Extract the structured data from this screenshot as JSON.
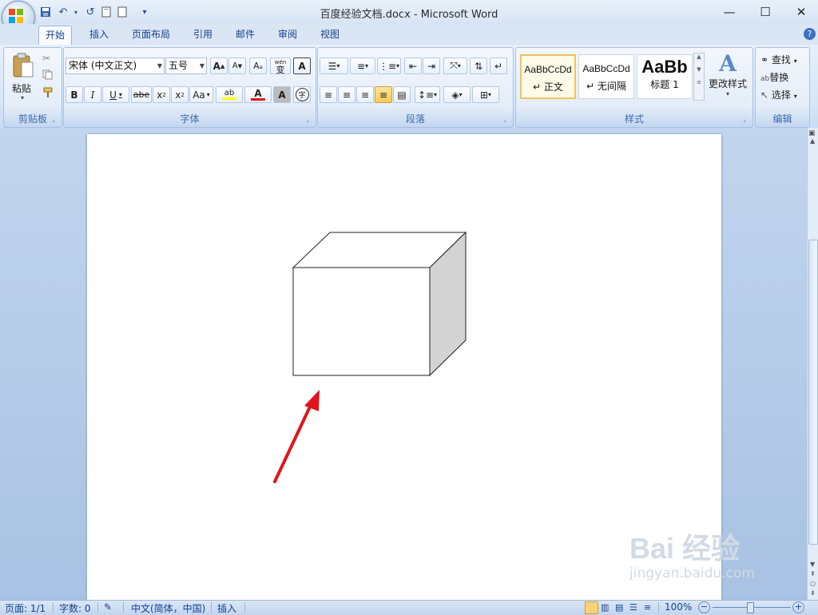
{
  "window": {
    "title": "百度经验文档.docx - Microsoft Word",
    "minimize": "—",
    "maximize": "☐",
    "close": "✕"
  },
  "tabs": [
    "开始",
    "插入",
    "页面布局",
    "引用",
    "邮件",
    "审阅",
    "视图"
  ],
  "clipboard": {
    "paste_label": "粘贴",
    "group_label": "剪贴板"
  },
  "font": {
    "font_name": "宋体 (中文正文)",
    "font_size": "五号",
    "group_label": "字体",
    "grow": "A",
    "shrink": "A",
    "pinyin": "wén",
    "pinyin_char": "文",
    "phonetic": "变",
    "border_char": "A",
    "bold": "B",
    "italic": "I",
    "underline": "U",
    "strike": "abe",
    "subscript": "x",
    "superscript": "x",
    "case": "Aa",
    "highlight": "ab",
    "font_color": "A",
    "shading_char": "A",
    "enclose_char": "字"
  },
  "paragraph": {
    "group_label": "段落"
  },
  "styles": {
    "items": [
      {
        "sample": "AaBbCcDd",
        "name": "正文"
      },
      {
        "sample": "AaBbCcDd",
        "name": "无间隔"
      },
      {
        "sample": "AaBb",
        "name": "标题 1"
      }
    ],
    "change_styles": "更改样式",
    "group_label": "样式"
  },
  "editing": {
    "find": "查找",
    "replace": "替换",
    "select": "选择",
    "group_label": "编辑"
  },
  "statusbar": {
    "page": "页面: 1/1",
    "words": "字数: 0",
    "language": "中文(简体，中国)",
    "mode": "插入",
    "zoom": "100%"
  },
  "watermark": {
    "brand": "Bai 经验",
    "url": "jingyan.baidu.com"
  },
  "colors": {
    "accent": "#15428b",
    "ribbon": "#dbe6f4",
    "arrow": "#e0141b",
    "cube_side": "#d3d3d3"
  }
}
